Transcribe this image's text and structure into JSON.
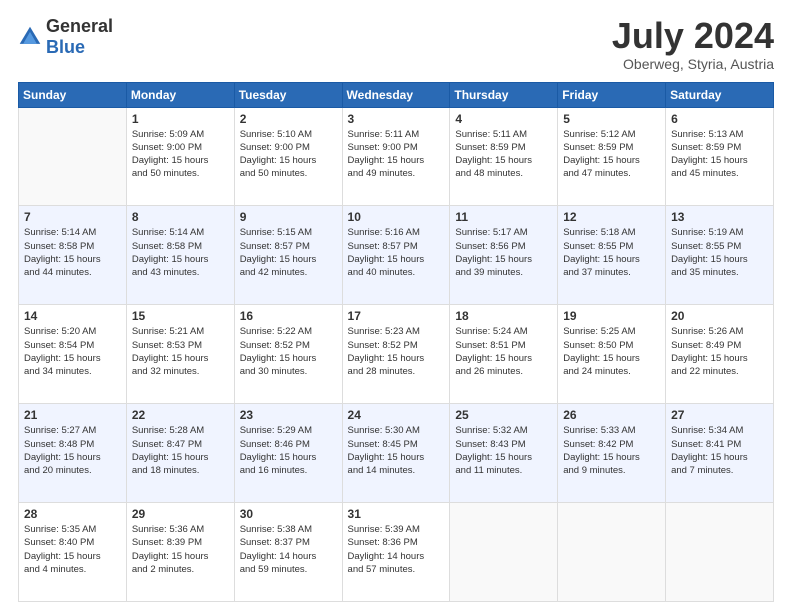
{
  "logo": {
    "general": "General",
    "blue": "Blue"
  },
  "header": {
    "month_year": "July 2024",
    "location": "Oberweg, Styria, Austria"
  },
  "days_of_week": [
    "Sunday",
    "Monday",
    "Tuesday",
    "Wednesday",
    "Thursday",
    "Friday",
    "Saturday"
  ],
  "weeks": [
    [
      {
        "day": "",
        "info": ""
      },
      {
        "day": "1",
        "info": "Sunrise: 5:09 AM\nSunset: 9:00 PM\nDaylight: 15 hours\nand 50 minutes."
      },
      {
        "day": "2",
        "info": "Sunrise: 5:10 AM\nSunset: 9:00 PM\nDaylight: 15 hours\nand 50 minutes."
      },
      {
        "day": "3",
        "info": "Sunrise: 5:11 AM\nSunset: 9:00 PM\nDaylight: 15 hours\nand 49 minutes."
      },
      {
        "day": "4",
        "info": "Sunrise: 5:11 AM\nSunset: 8:59 PM\nDaylight: 15 hours\nand 48 minutes."
      },
      {
        "day": "5",
        "info": "Sunrise: 5:12 AM\nSunset: 8:59 PM\nDaylight: 15 hours\nand 47 minutes."
      },
      {
        "day": "6",
        "info": "Sunrise: 5:13 AM\nSunset: 8:59 PM\nDaylight: 15 hours\nand 45 minutes."
      }
    ],
    [
      {
        "day": "7",
        "info": "Sunrise: 5:14 AM\nSunset: 8:58 PM\nDaylight: 15 hours\nand 44 minutes."
      },
      {
        "day": "8",
        "info": "Sunrise: 5:14 AM\nSunset: 8:58 PM\nDaylight: 15 hours\nand 43 minutes."
      },
      {
        "day": "9",
        "info": "Sunrise: 5:15 AM\nSunset: 8:57 PM\nDaylight: 15 hours\nand 42 minutes."
      },
      {
        "day": "10",
        "info": "Sunrise: 5:16 AM\nSunset: 8:57 PM\nDaylight: 15 hours\nand 40 minutes."
      },
      {
        "day": "11",
        "info": "Sunrise: 5:17 AM\nSunset: 8:56 PM\nDaylight: 15 hours\nand 39 minutes."
      },
      {
        "day": "12",
        "info": "Sunrise: 5:18 AM\nSunset: 8:55 PM\nDaylight: 15 hours\nand 37 minutes."
      },
      {
        "day": "13",
        "info": "Sunrise: 5:19 AM\nSunset: 8:55 PM\nDaylight: 15 hours\nand 35 minutes."
      }
    ],
    [
      {
        "day": "14",
        "info": "Sunrise: 5:20 AM\nSunset: 8:54 PM\nDaylight: 15 hours\nand 34 minutes."
      },
      {
        "day": "15",
        "info": "Sunrise: 5:21 AM\nSunset: 8:53 PM\nDaylight: 15 hours\nand 32 minutes."
      },
      {
        "day": "16",
        "info": "Sunrise: 5:22 AM\nSunset: 8:52 PM\nDaylight: 15 hours\nand 30 minutes."
      },
      {
        "day": "17",
        "info": "Sunrise: 5:23 AM\nSunset: 8:52 PM\nDaylight: 15 hours\nand 28 minutes."
      },
      {
        "day": "18",
        "info": "Sunrise: 5:24 AM\nSunset: 8:51 PM\nDaylight: 15 hours\nand 26 minutes."
      },
      {
        "day": "19",
        "info": "Sunrise: 5:25 AM\nSunset: 8:50 PM\nDaylight: 15 hours\nand 24 minutes."
      },
      {
        "day": "20",
        "info": "Sunrise: 5:26 AM\nSunset: 8:49 PM\nDaylight: 15 hours\nand 22 minutes."
      }
    ],
    [
      {
        "day": "21",
        "info": "Sunrise: 5:27 AM\nSunset: 8:48 PM\nDaylight: 15 hours\nand 20 minutes."
      },
      {
        "day": "22",
        "info": "Sunrise: 5:28 AM\nSunset: 8:47 PM\nDaylight: 15 hours\nand 18 minutes."
      },
      {
        "day": "23",
        "info": "Sunrise: 5:29 AM\nSunset: 8:46 PM\nDaylight: 15 hours\nand 16 minutes."
      },
      {
        "day": "24",
        "info": "Sunrise: 5:30 AM\nSunset: 8:45 PM\nDaylight: 15 hours\nand 14 minutes."
      },
      {
        "day": "25",
        "info": "Sunrise: 5:32 AM\nSunset: 8:43 PM\nDaylight: 15 hours\nand 11 minutes."
      },
      {
        "day": "26",
        "info": "Sunrise: 5:33 AM\nSunset: 8:42 PM\nDaylight: 15 hours\nand 9 minutes."
      },
      {
        "day": "27",
        "info": "Sunrise: 5:34 AM\nSunset: 8:41 PM\nDaylight: 15 hours\nand 7 minutes."
      }
    ],
    [
      {
        "day": "28",
        "info": "Sunrise: 5:35 AM\nSunset: 8:40 PM\nDaylight: 15 hours\nand 4 minutes."
      },
      {
        "day": "29",
        "info": "Sunrise: 5:36 AM\nSunset: 8:39 PM\nDaylight: 15 hours\nand 2 minutes."
      },
      {
        "day": "30",
        "info": "Sunrise: 5:38 AM\nSunset: 8:37 PM\nDaylight: 14 hours\nand 59 minutes."
      },
      {
        "day": "31",
        "info": "Sunrise: 5:39 AM\nSunset: 8:36 PM\nDaylight: 14 hours\nand 57 minutes."
      },
      {
        "day": "",
        "info": ""
      },
      {
        "day": "",
        "info": ""
      },
      {
        "day": "",
        "info": ""
      }
    ]
  ]
}
